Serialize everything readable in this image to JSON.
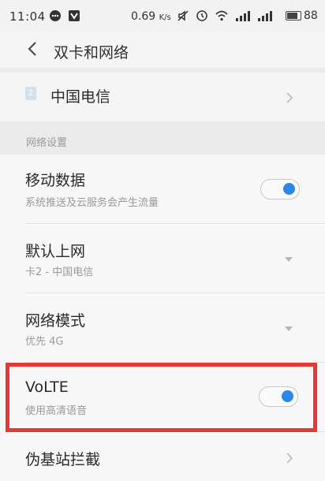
{
  "status_bar": {
    "time": "11:04",
    "net_speed": "0.69",
    "net_unit": "K/s",
    "battery": "88"
  },
  "header": {
    "title": "双卡和网络"
  },
  "sim": {
    "number": "2",
    "carrier": "中国电信"
  },
  "section": {
    "title": "网络设置"
  },
  "rows": {
    "mobile_data": {
      "title": "移动数据",
      "subtitle": "系统推送及云服务会产生流量",
      "enabled": true
    },
    "default_internet": {
      "title": "默认上网",
      "subtitle": "卡2 - 中国电信"
    },
    "network_mode": {
      "title": "网络模式",
      "subtitle": "优先 4G"
    },
    "volte": {
      "title": "VoLTE",
      "subtitle": "使用高清语音",
      "enabled": true
    },
    "pseudo_bs": {
      "title": "伪基站拦截"
    }
  },
  "colors": {
    "toggle_on": "#2a88e6",
    "highlight": "#e53935"
  }
}
